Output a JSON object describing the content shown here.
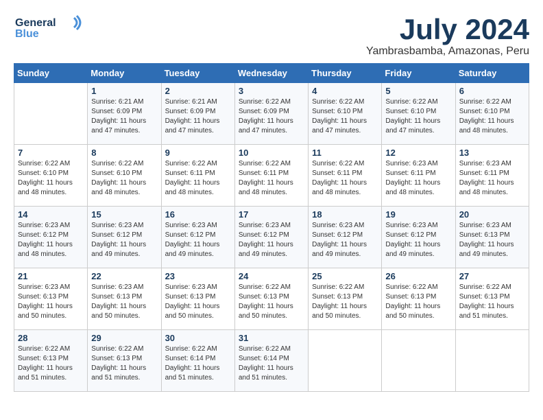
{
  "header": {
    "logo_line1": "General",
    "logo_line2": "Blue",
    "month": "July 2024",
    "location": "Yambrasbamba, Amazonas, Peru"
  },
  "weekdays": [
    "Sunday",
    "Monday",
    "Tuesday",
    "Wednesday",
    "Thursday",
    "Friday",
    "Saturday"
  ],
  "weeks": [
    [
      {
        "day": "",
        "sunrise": "",
        "sunset": "",
        "daylight": ""
      },
      {
        "day": "1",
        "sunrise": "Sunrise: 6:21 AM",
        "sunset": "Sunset: 6:09 PM",
        "daylight": "Daylight: 11 hours and 47 minutes."
      },
      {
        "day": "2",
        "sunrise": "Sunrise: 6:21 AM",
        "sunset": "Sunset: 6:09 PM",
        "daylight": "Daylight: 11 hours and 47 minutes."
      },
      {
        "day": "3",
        "sunrise": "Sunrise: 6:22 AM",
        "sunset": "Sunset: 6:09 PM",
        "daylight": "Daylight: 11 hours and 47 minutes."
      },
      {
        "day": "4",
        "sunrise": "Sunrise: 6:22 AM",
        "sunset": "Sunset: 6:10 PM",
        "daylight": "Daylight: 11 hours and 47 minutes."
      },
      {
        "day": "5",
        "sunrise": "Sunrise: 6:22 AM",
        "sunset": "Sunset: 6:10 PM",
        "daylight": "Daylight: 11 hours and 47 minutes."
      },
      {
        "day": "6",
        "sunrise": "Sunrise: 6:22 AM",
        "sunset": "Sunset: 6:10 PM",
        "daylight": "Daylight: 11 hours and 48 minutes."
      }
    ],
    [
      {
        "day": "7",
        "sunrise": "Sunrise: 6:22 AM",
        "sunset": "Sunset: 6:10 PM",
        "daylight": "Daylight: 11 hours and 48 minutes."
      },
      {
        "day": "8",
        "sunrise": "Sunrise: 6:22 AM",
        "sunset": "Sunset: 6:10 PM",
        "daylight": "Daylight: 11 hours and 48 minutes."
      },
      {
        "day": "9",
        "sunrise": "Sunrise: 6:22 AM",
        "sunset": "Sunset: 6:11 PM",
        "daylight": "Daylight: 11 hours and 48 minutes."
      },
      {
        "day": "10",
        "sunrise": "Sunrise: 6:22 AM",
        "sunset": "Sunset: 6:11 PM",
        "daylight": "Daylight: 11 hours and 48 minutes."
      },
      {
        "day": "11",
        "sunrise": "Sunrise: 6:22 AM",
        "sunset": "Sunset: 6:11 PM",
        "daylight": "Daylight: 11 hours and 48 minutes."
      },
      {
        "day": "12",
        "sunrise": "Sunrise: 6:23 AM",
        "sunset": "Sunset: 6:11 PM",
        "daylight": "Daylight: 11 hours and 48 minutes."
      },
      {
        "day": "13",
        "sunrise": "Sunrise: 6:23 AM",
        "sunset": "Sunset: 6:11 PM",
        "daylight": "Daylight: 11 hours and 48 minutes."
      }
    ],
    [
      {
        "day": "14",
        "sunrise": "Sunrise: 6:23 AM",
        "sunset": "Sunset: 6:12 PM",
        "daylight": "Daylight: 11 hours and 48 minutes."
      },
      {
        "day": "15",
        "sunrise": "Sunrise: 6:23 AM",
        "sunset": "Sunset: 6:12 PM",
        "daylight": "Daylight: 11 hours and 49 minutes."
      },
      {
        "day": "16",
        "sunrise": "Sunrise: 6:23 AM",
        "sunset": "Sunset: 6:12 PM",
        "daylight": "Daylight: 11 hours and 49 minutes."
      },
      {
        "day": "17",
        "sunrise": "Sunrise: 6:23 AM",
        "sunset": "Sunset: 6:12 PM",
        "daylight": "Daylight: 11 hours and 49 minutes."
      },
      {
        "day": "18",
        "sunrise": "Sunrise: 6:23 AM",
        "sunset": "Sunset: 6:12 PM",
        "daylight": "Daylight: 11 hours and 49 minutes."
      },
      {
        "day": "19",
        "sunrise": "Sunrise: 6:23 AM",
        "sunset": "Sunset: 6:12 PM",
        "daylight": "Daylight: 11 hours and 49 minutes."
      },
      {
        "day": "20",
        "sunrise": "Sunrise: 6:23 AM",
        "sunset": "Sunset: 6:13 PM",
        "daylight": "Daylight: 11 hours and 49 minutes."
      }
    ],
    [
      {
        "day": "21",
        "sunrise": "Sunrise: 6:23 AM",
        "sunset": "Sunset: 6:13 PM",
        "daylight": "Daylight: 11 hours and 50 minutes."
      },
      {
        "day": "22",
        "sunrise": "Sunrise: 6:23 AM",
        "sunset": "Sunset: 6:13 PM",
        "daylight": "Daylight: 11 hours and 50 minutes."
      },
      {
        "day": "23",
        "sunrise": "Sunrise: 6:23 AM",
        "sunset": "Sunset: 6:13 PM",
        "daylight": "Daylight: 11 hours and 50 minutes."
      },
      {
        "day": "24",
        "sunrise": "Sunrise: 6:22 AM",
        "sunset": "Sunset: 6:13 PM",
        "daylight": "Daylight: 11 hours and 50 minutes."
      },
      {
        "day": "25",
        "sunrise": "Sunrise: 6:22 AM",
        "sunset": "Sunset: 6:13 PM",
        "daylight": "Daylight: 11 hours and 50 minutes."
      },
      {
        "day": "26",
        "sunrise": "Sunrise: 6:22 AM",
        "sunset": "Sunset: 6:13 PM",
        "daylight": "Daylight: 11 hours and 50 minutes."
      },
      {
        "day": "27",
        "sunrise": "Sunrise: 6:22 AM",
        "sunset": "Sunset: 6:13 PM",
        "daylight": "Daylight: 11 hours and 51 minutes."
      }
    ],
    [
      {
        "day": "28",
        "sunrise": "Sunrise: 6:22 AM",
        "sunset": "Sunset: 6:13 PM",
        "daylight": "Daylight: 11 hours and 51 minutes."
      },
      {
        "day": "29",
        "sunrise": "Sunrise: 6:22 AM",
        "sunset": "Sunset: 6:13 PM",
        "daylight": "Daylight: 11 hours and 51 minutes."
      },
      {
        "day": "30",
        "sunrise": "Sunrise: 6:22 AM",
        "sunset": "Sunset: 6:14 PM",
        "daylight": "Daylight: 11 hours and 51 minutes."
      },
      {
        "day": "31",
        "sunrise": "Sunrise: 6:22 AM",
        "sunset": "Sunset: 6:14 PM",
        "daylight": "Daylight: 11 hours and 51 minutes."
      },
      {
        "day": "",
        "sunrise": "",
        "sunset": "",
        "daylight": ""
      },
      {
        "day": "",
        "sunrise": "",
        "sunset": "",
        "daylight": ""
      },
      {
        "day": "",
        "sunrise": "",
        "sunset": "",
        "daylight": ""
      }
    ]
  ]
}
